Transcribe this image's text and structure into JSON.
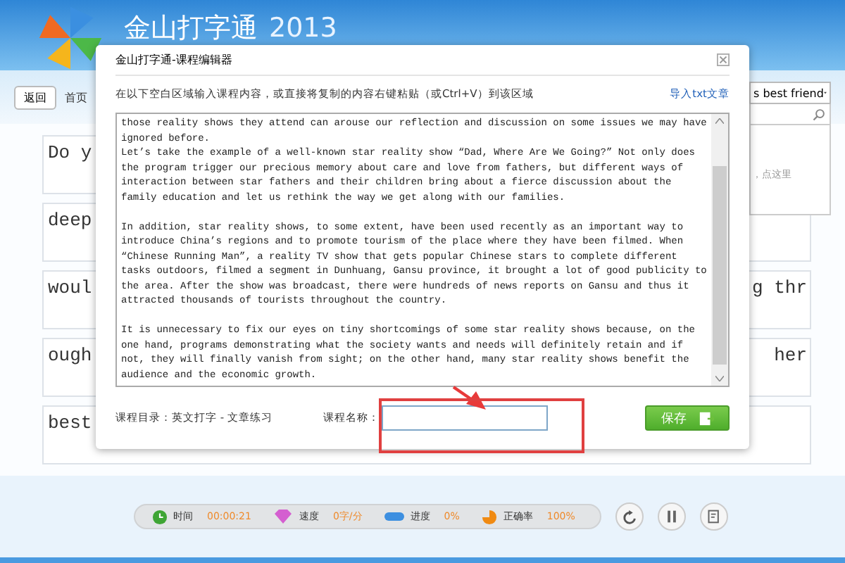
{
  "app_header": {
    "title": "金山打字通",
    "year": "2013"
  },
  "nav": {
    "back": "返回",
    "home": "首页"
  },
  "lesson_picker": {
    "value": "s best friend",
    "hint": "，点这里"
  },
  "typing_rows": [
    {
      "start": "Do y"
    },
    {
      "start": "deep"
    },
    {
      "start": "woul",
      "end": "g thr"
    },
    {
      "start": "ough",
      "end": "her"
    },
    {
      "start": "best"
    }
  ],
  "dialog": {
    "title": "金山打字通-课程编辑器",
    "instruction": "在以下空白区域输入课程内容，或直接将复制的内容右键粘贴（或Ctrl+V）到该区域",
    "import_link": "导入txt文章",
    "paragraphs": [
      "those reality shows they attend can arouse our reflection and discussion on some issues we may have ignored before.\nLet’s take the example of a well-known star reality show “Dad, Where Are We Going?” Not only does the program trigger our precious memory about care and love from fathers, but different ways of interaction between star fathers and their children bring about a fierce discussion about the family education and let us rethink the way we get along with our families.",
      "In addition, star reality shows, to some extent, have been used recently as an important way to introduce China’s regions and to promote tourism of the place where they have been filmed. When “Chinese Running Man”, a reality TV show that gets popular Chinese stars to complete different tasks outdoors, filmed a segment in Dunhuang, Gansu province, it brought a lot of good publicity to the area. After the show was broadcast, there were hundreds of news reports on Gansu and thus it attracted thousands of tourists throughout the country.",
      "It is unnecessary to fix our eyes on tiny shortcomings of some star reality shows because, on the one hand, programs demonstrating what the society wants and needs will definitely retain and if not, they will finally vanish from sight; on the other hand, many star reality shows benefit the audience and the economic growth."
    ],
    "catalog": "课程目录：英文打字 - 文章练习",
    "name_label": "课程名称：",
    "save_button": "保存"
  },
  "status": [
    {
      "kind": "time",
      "label": "时间",
      "value": "00:00:21"
    },
    {
      "kind": "speed",
      "label": "速度",
      "value": "0字/分"
    },
    {
      "kind": "progress",
      "label": "进度",
      "value": "0%"
    },
    {
      "kind": "accuracy",
      "label": "正确率",
      "value": "100%"
    }
  ],
  "controls": [
    {
      "kind": "restart"
    },
    {
      "kind": "pause"
    },
    {
      "kind": "report"
    }
  ]
}
